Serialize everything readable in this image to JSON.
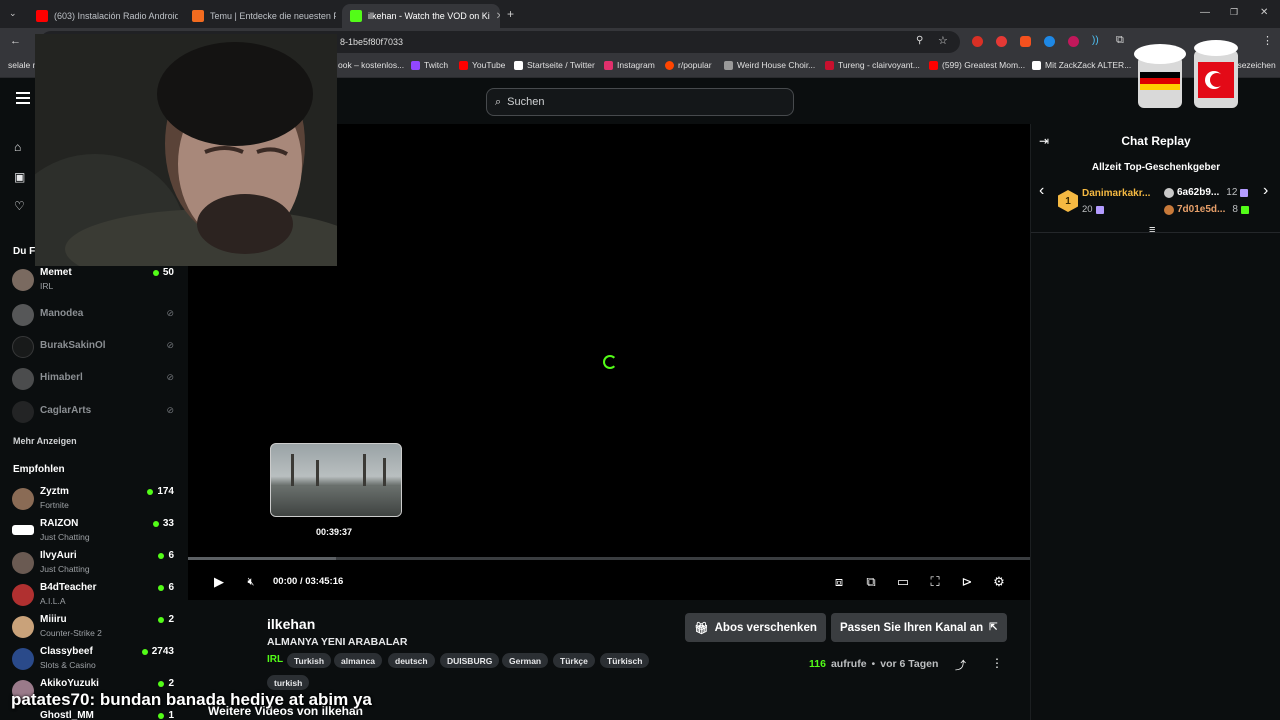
{
  "browser": {
    "tabs": [
      {
        "title": "(603) Instalación Radio Android",
        "color": "#ff0000"
      },
      {
        "title": "Temu | Entdecke die neuesten F",
        "color": "#f26b1f"
      },
      {
        "title": "ilkehan - Watch the VOD on Ki",
        "color": "#53fc18"
      }
    ],
    "new_tab": "+",
    "url_fragment": "8-1be5f80f7033",
    "bookmarks": [
      {
        "label": "selale m",
        "color": "#e8e8e8"
      },
      {
        "label": "ook – kostenlos...",
        "color": "#1877f2"
      },
      {
        "label": "Twitch",
        "color": "#9146ff"
      },
      {
        "label": "YouTube",
        "color": "#ff0000"
      },
      {
        "label": "Startseite / Twitter",
        "color": "#ffffff"
      },
      {
        "label": "Instagram",
        "color": "#e1306c"
      },
      {
        "label": "r/popular",
        "color": "#ff4500"
      },
      {
        "label": "Weird House Choir...",
        "color": "#cccccc"
      },
      {
        "label": "Tureng - clairvoyant...",
        "color": "#c8102e"
      },
      {
        "label": "(599) Greatest Mom...",
        "color": "#ff0000"
      },
      {
        "label": "Mit ZackZack ALTER...",
        "color": "#ffffff"
      },
      {
        "label": "Lesezeichen",
        "color": "#e8e8e8"
      }
    ]
  },
  "header": {
    "search_placeholder": "Suchen"
  },
  "sidebar": {
    "following_heading": "Du F",
    "following": [
      {
        "name": "Memet",
        "category": "IRL",
        "viewers": "50",
        "live": true,
        "avatar_color": "#7a6a60"
      },
      {
        "name": "Manodea",
        "live": false,
        "avatar_color": "#888"
      },
      {
        "name": "BurakSakinOl",
        "live": false,
        "avatar_color": "#222"
      },
      {
        "name": "Himaberl",
        "live": false,
        "avatar_color": "#777"
      },
      {
        "name": "CaglarArts",
        "live": false,
        "avatar_color": "#333"
      }
    ],
    "show_more": "Mehr Anzeigen",
    "recommended_heading": "Empfohlen",
    "recommended": [
      {
        "name": "Zyztm",
        "category": "Fortnite",
        "viewers": "174",
        "avatar_color": "#8a6b55"
      },
      {
        "name": "RAIZON",
        "category": "Just Chatting",
        "viewers": "33",
        "avatar_color": "#ffffff"
      },
      {
        "name": "IlvyAuri",
        "category": "Just Chatting",
        "viewers": "6",
        "avatar_color": "#6a5a52"
      },
      {
        "name": "B4dTeacher",
        "category": "A.I.L.A",
        "viewers": "6",
        "avatar_color": "#b03030"
      },
      {
        "name": "Miiiru",
        "category": "Counter-Strike 2",
        "viewers": "2",
        "avatar_color": "#c9a27a"
      },
      {
        "name": "Classybeef",
        "category": "Slots & Casino",
        "viewers": "2743",
        "avatar_color": "#2a4a8a"
      },
      {
        "name": "AkikoYuzuki",
        "category": "",
        "viewers": "2",
        "avatar_color": "#9a7a8a"
      },
      {
        "name": "Ghostl_MM",
        "category": "",
        "viewers": "1",
        "avatar_color": "#555"
      }
    ]
  },
  "player": {
    "preview_time": "00:39:37",
    "current_time": "00:00",
    "separator": "/",
    "duration": "03:45:16",
    "progress_fraction": 0.176
  },
  "chat": {
    "title": "Chat Replay",
    "gifter_title": "Allzeit Top-Geschenkgeber",
    "top_gifter": {
      "rank": "1",
      "name": "Danimarkakr...",
      "count": "20"
    },
    "gifters": [
      {
        "name": "6a62b9...",
        "count": "12",
        "badge_color": "#b49cff"
      },
      {
        "name": "7d01e5d...",
        "count": "8",
        "badge_color": "#53fc18"
      }
    ]
  },
  "video": {
    "channel": "ilkehan",
    "title": "ALMANYA YENI ARABALAR",
    "category": "IRL",
    "tags": [
      "Turkish",
      "almanca",
      "deutsch",
      "DUISBURG",
      "German",
      "Türkçe",
      "Türkisch",
      "turkish"
    ],
    "gift_button": "Abos verschenken",
    "customize_button": "Passen Sie Ihren Kanal an",
    "views_count": "116",
    "views_label": "aufrufe",
    "bullet": "•",
    "age": "vor 6 Tagen",
    "more_videos": "Weitere Videos von ilkehan"
  },
  "overlay": {
    "caption_user": "patates70",
    "caption_text": ": bundan banada hediye at abim ya"
  },
  "colors": {
    "accent": "#53fc18",
    "background": "#0b0e0f",
    "gold": "#f5b942"
  }
}
